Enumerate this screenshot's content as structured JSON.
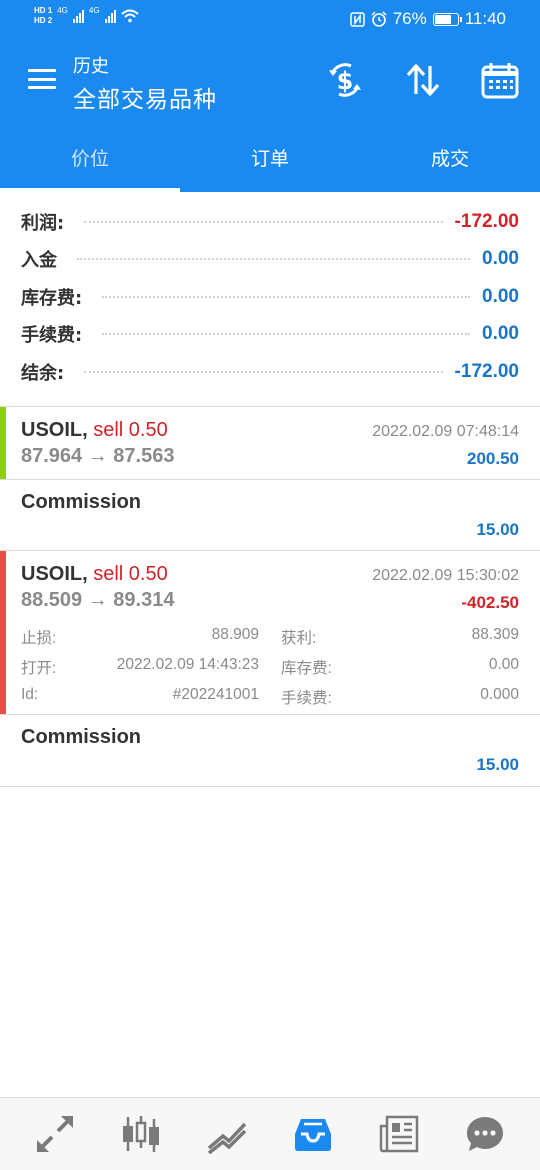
{
  "status_bar": {
    "sim1": "HD 1",
    "sim2": "HD 2",
    "net1": "4G",
    "net2": "4G",
    "battery_percent": "76%",
    "battery_level": 0.76,
    "time": "11:40",
    "icons": [
      "nfc-icon",
      "alarm-icon",
      "wifi-icon",
      "signal-icon",
      "battery-icon"
    ]
  },
  "app_bar": {
    "subtitle": "历史",
    "title": "全部交易品种",
    "icons": [
      "menu-icon",
      "currency-exchange-icon",
      "sort-icon",
      "calendar-icon"
    ]
  },
  "tabs": [
    {
      "label": "价位",
      "active": true
    },
    {
      "label": "订单",
      "active": false
    },
    {
      "label": "成交",
      "active": false
    }
  ],
  "summary": [
    {
      "label": "利润:",
      "value": "-172.00",
      "negative": true
    },
    {
      "label": "入金",
      "value": "0.00",
      "negative": false
    },
    {
      "label": "库存费:",
      "value": "0.00",
      "negative": false
    },
    {
      "label": "手续费:",
      "value": "0.00",
      "negative": false
    },
    {
      "label": "结余:",
      "value": "-172.00",
      "negative": false
    }
  ],
  "deals": [
    {
      "symbol": "USOIL,",
      "side": "sell 0.50",
      "time": "2022.02.09 07:48:14",
      "prices": "87.964 → 87.563",
      "profit": "200.50",
      "accent": "#8ccd1c"
    },
    {
      "symbol": "USOIL,",
      "side": "sell 0.50",
      "time": "2022.02.09 15:30:02",
      "prices": "88.509 → 89.314",
      "profit": "-402.50",
      "accent": "#e0524a",
      "details": {
        "sl_label": "止损:",
        "sl_value": "88.909",
        "tp_label": "获利:",
        "tp_value": "88.309",
        "open_label": "打开:",
        "open_value": "2022.02.09 14:43:23",
        "swap_label": "库存费:",
        "swap_value": "0.00",
        "id_label": "Id:",
        "id_value": "#202241001",
        "fee_label": "手续费:",
        "fee_value": "0.000"
      }
    }
  ],
  "commissions": [
    {
      "label": "Commission",
      "value": "15.00"
    },
    {
      "label": "Commission",
      "value": "15.00"
    }
  ],
  "bottom_nav": [
    "trade-arrows-icon",
    "candlestick-icon",
    "chart-line-icon",
    "history-inbox-icon",
    "news-icon",
    "chat-icon"
  ],
  "colors": {
    "primary": "#1a8af0",
    "negative": "#d0242a",
    "positive": "#1a74c8",
    "buy_accent": "#8ccd1c",
    "sell_accent": "#e0524a"
  }
}
